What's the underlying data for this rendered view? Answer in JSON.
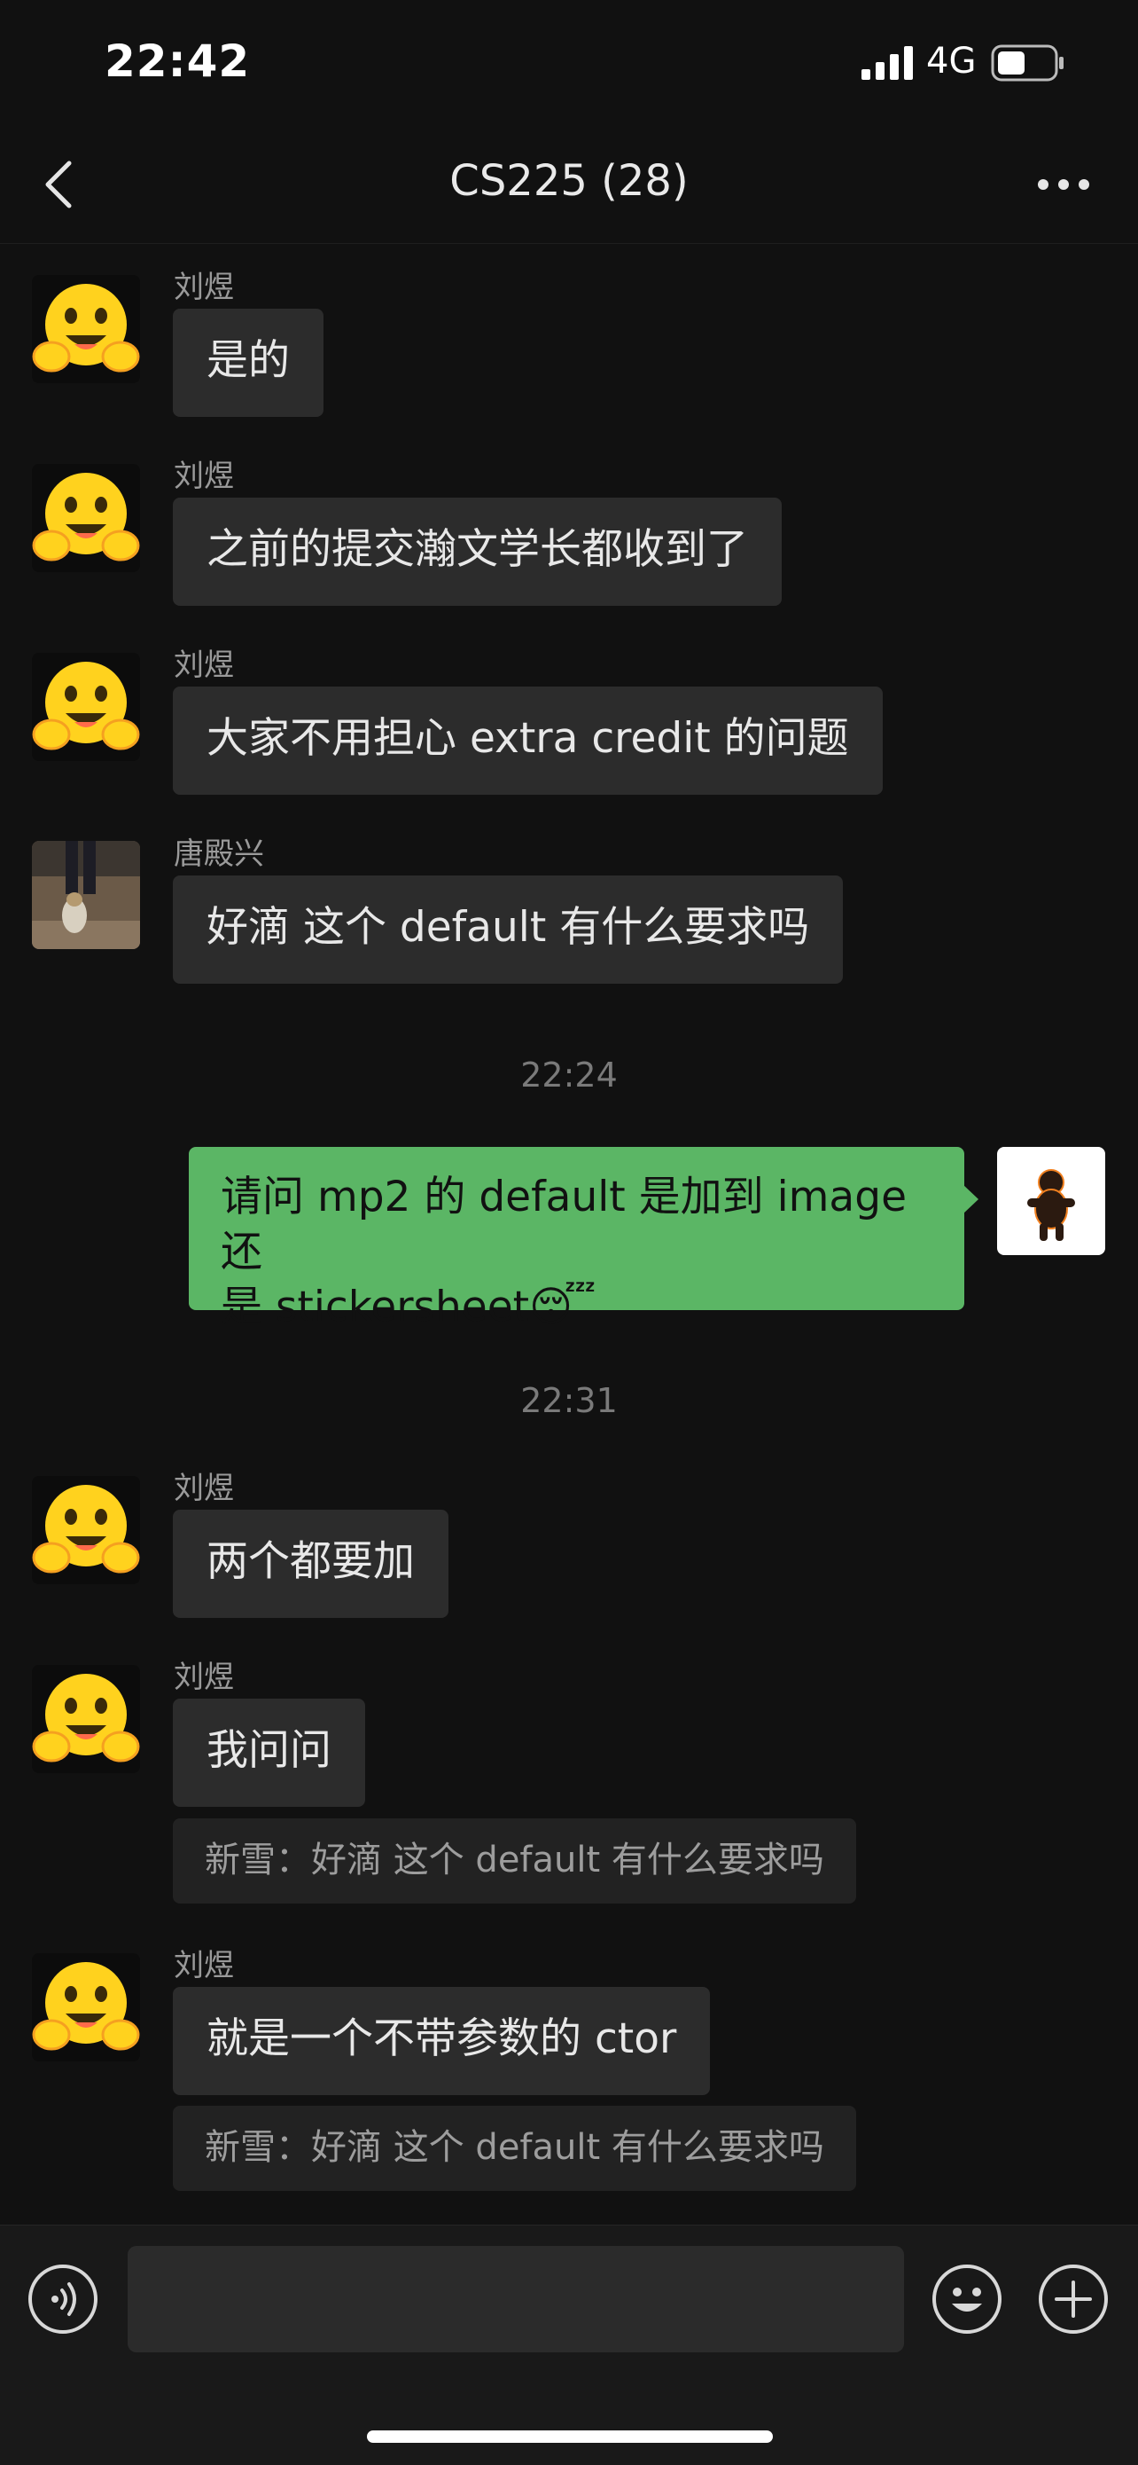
{
  "status_bar": {
    "time": "22:42",
    "network": "4G"
  },
  "header": {
    "title": "CS225 (28)"
  },
  "messages": [
    {
      "sender": "刘煜",
      "text": "是的"
    },
    {
      "sender": "刘煜",
      "text": "之前的提交瀚文学长都收到了"
    },
    {
      "sender": "刘煜",
      "text": "大家不用担心 extra credit 的问题"
    },
    {
      "sender": "唐殿兴",
      "text": "好滴 这个 default 有什么要求吗"
    }
  ],
  "timestamp_1": "22:24",
  "my_message": {
    "line1": "请问 mp2 的 default 是加到 image 还",
    "line2": "是 stickersheet",
    "emoji": "😴"
  },
  "timestamp_2": "22:31",
  "messages2": [
    {
      "sender": "刘煜",
      "text": "两个都要加"
    },
    {
      "sender": "刘煜",
      "text": "我问问",
      "quote": "新雪：好滴 这个 default 有什么要求吗"
    },
    {
      "sender": "刘煜",
      "text": "就是一个不带参数的 ctor",
      "quote": "新雪：好滴 这个 default 有什么要求吗"
    }
  ],
  "icons": {
    "back": "chevron-left-icon",
    "more": "more-icon",
    "voice": "voice-icon",
    "emoji": "emoji-icon",
    "add": "add-icon"
  },
  "colors": {
    "my_bubble": "#5bb665",
    "their_bubble": "#2c2c2c",
    "background": "#111111"
  }
}
